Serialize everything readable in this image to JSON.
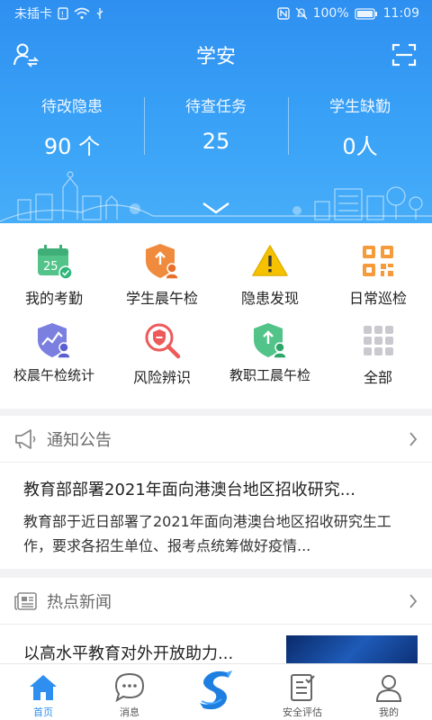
{
  "status_bar": {
    "carrier": "未插卡",
    "battery": "100%",
    "time": "11:09"
  },
  "header": {
    "title": "学安",
    "stats": [
      {
        "label": "待改隐患",
        "value": "90 个"
      },
      {
        "label": "待查任务",
        "value": "25"
      },
      {
        "label": "学生缺勤",
        "value": "0人"
      }
    ]
  },
  "grid": {
    "items": [
      {
        "label": "我的考勤",
        "icon": "calendar-check-icon",
        "calendar_day": "25"
      },
      {
        "label": "学生晨午检",
        "icon": "shield-upload-icon"
      },
      {
        "label": "隐患发现",
        "icon": "warning-icon"
      },
      {
        "label": "日常巡检",
        "icon": "qr-code-icon"
      },
      {
        "label": "校晨午检统计",
        "icon": "shield-stats-icon"
      },
      {
        "label": "风险辨识",
        "icon": "risk-search-icon"
      },
      {
        "label": "教职工晨午检",
        "icon": "staff-shield-icon"
      },
      {
        "label": "全部",
        "icon": "apps-grid-icon"
      }
    ]
  },
  "notice": {
    "title": "通知公告",
    "headline": "教育部部署2021年面向港澳台地区招收研究...",
    "body": "教育部于近日部署了2021年面向港澳台地区招收研究生工作，要求各招生单位、报考点统筹做好疫情..."
  },
  "news": {
    "title": "热点新闻",
    "headline": "以高水平教育对外开放助力..."
  },
  "tabbar": {
    "tabs": [
      {
        "label": "首页",
        "icon": "home-icon"
      },
      {
        "label": "消息",
        "icon": "message-icon"
      },
      {
        "label": "",
        "icon": "app-logo-icon"
      },
      {
        "label": "安全评估",
        "icon": "clipboard-icon"
      },
      {
        "label": "我的",
        "icon": "profile-icon"
      }
    ]
  },
  "colors": {
    "primary": "#2e8ff0",
    "orange": "#f08a3c",
    "green": "#52c48a",
    "yellow": "#f6c200"
  }
}
